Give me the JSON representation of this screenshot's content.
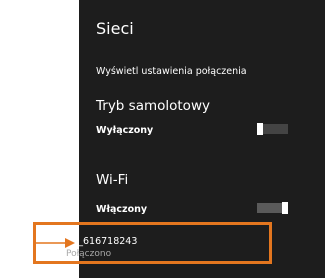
{
  "panel": {
    "title": "Sieci",
    "connection_settings_link": "Wyświetl ustawienia połączenia",
    "airplane": {
      "label": "Tryb samolotowy",
      "state": "Wyłączony",
      "on": false
    },
    "wifi": {
      "label": "Wi-Fi",
      "state": "Włączony",
      "on": true
    },
    "networks": [
      {
        "name": "AP_616718243",
        "status": "Połączono",
        "icon": "wifi-signal-secured-icon"
      }
    ]
  },
  "annotation": {
    "color": "#e3761f",
    "icon": "arrow-right-icon"
  }
}
